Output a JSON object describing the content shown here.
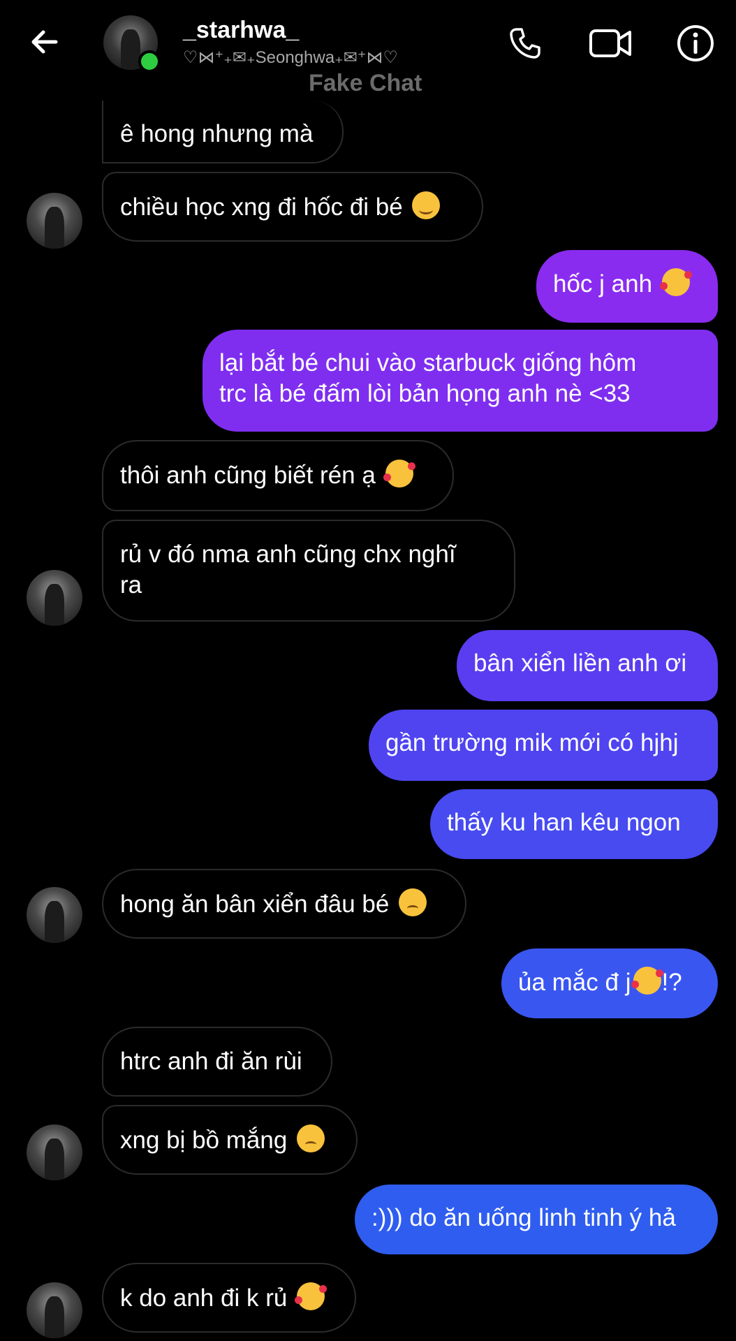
{
  "header": {
    "username": "_starhwa_",
    "subtitle": "♡⋈⁺₊✉︎₊Seonghwa₊✉︎⁺⋈♡",
    "watermark": "Fake Chat",
    "icons": {
      "back": "back-arrow-icon",
      "call": "phone-icon",
      "video": "video-camera-icon",
      "info": "info-icon"
    },
    "online_color": "#2ecc40"
  },
  "messages": [
    {
      "side": "in",
      "text": "ê hong nhưng mà",
      "emoji": ""
    },
    {
      "side": "in",
      "text": "chiều học xng đi hốc đi bé",
      "emoji": "smile"
    },
    {
      "side": "out",
      "text": "hốc j anh",
      "emoji": "love"
    },
    {
      "side": "out",
      "text": "lại bắt bé chui vào starbuck giống hôm",
      "text2": "trc là bé đấm lòi bản họng anh nè <33",
      "emoji": ""
    },
    {
      "side": "in",
      "text": "thôi anh cũng biết rén ạ",
      "emoji": "love"
    },
    {
      "side": "in",
      "text": "rủ v đó nma anh cũng chx nghĩ",
      "text2": "ra",
      "emoji": ""
    },
    {
      "side": "out",
      "text": "bân xiển liền anh ơi",
      "emoji": ""
    },
    {
      "side": "out",
      "text": "gần trường mik mới có hjhj",
      "emoji": ""
    },
    {
      "side": "out",
      "text": "thấy ku han kêu ngon",
      "emoji": ""
    },
    {
      "side": "in",
      "text": "hong ăn bân xiển đâu bé",
      "emoji": "sad"
    },
    {
      "side": "out",
      "text": "ủa mắc đ j",
      "emoji": "love",
      "suffix": "!?"
    },
    {
      "side": "in",
      "text": "htrc anh đi ăn rùi",
      "emoji": ""
    },
    {
      "side": "in",
      "text": "xng bị bồ mắng",
      "emoji": "sad"
    },
    {
      "side": "out",
      "text": ":))) do ăn uống linh tinh ý hả",
      "emoji": ""
    },
    {
      "side": "in",
      "text": "k do anh đi k rủ",
      "emoji": "love"
    }
  ],
  "colors": {
    "background": "#000000",
    "incoming_border": "#2b2b2b",
    "outgoing_top": "#8c2cf0",
    "outgoing_bottom": "#2f5df0"
  }
}
